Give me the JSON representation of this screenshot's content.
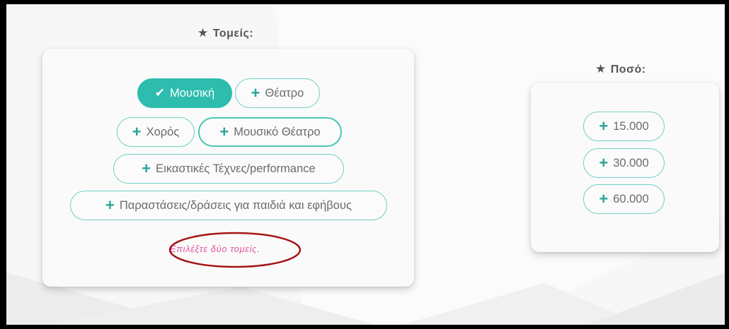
{
  "sectors": {
    "label": "Τομείς:",
    "options": [
      {
        "label": "Μουσική",
        "selected": true
      },
      {
        "label": "Θέατρο",
        "selected": false
      },
      {
        "label": "Χορός",
        "selected": false
      },
      {
        "label": "Μουσικό Θέατρο",
        "selected": false
      },
      {
        "label": "Εικαστικές Τέχνες/performance",
        "selected": false
      },
      {
        "label": "Παραστάσεις/δράσεις για παιδιά και εφήβους",
        "selected": false
      }
    ],
    "hint": "Επιλέξτε δύο τομείς."
  },
  "amount": {
    "label": "Ποσό:",
    "options": [
      {
        "label": "15.000"
      },
      {
        "label": "30.000"
      },
      {
        "label": "60.000"
      }
    ]
  },
  "icons": {
    "required": "★",
    "add": "+",
    "check": "✔"
  },
  "colors": {
    "accent": "#2dbcae",
    "border": "#6fcfc4",
    "hint": "#e0569a",
    "annotation": "#a51414"
  }
}
